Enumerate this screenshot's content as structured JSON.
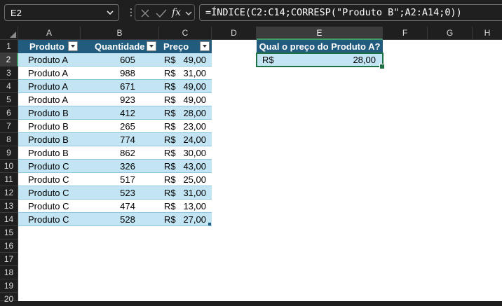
{
  "formula_bar": {
    "name_box": "E2",
    "fx_label": "fx",
    "formula": "=ÍNDICE(C2:C14;CORRESP(\"Produto B\";A2:A14;0))"
  },
  "columns": [
    "A",
    "B",
    "C",
    "D",
    "E",
    "F",
    "G",
    "H"
  ],
  "rows": [
    "1",
    "2",
    "3",
    "4",
    "5",
    "6",
    "7",
    "8",
    "9",
    "10",
    "11",
    "12",
    "13",
    "14",
    "15",
    "16",
    "17",
    "18",
    "19",
    "20"
  ],
  "table": {
    "headers": {
      "produto": "Produto",
      "quantidade": "Quantidade",
      "preco": "Preço"
    },
    "currency": "R$",
    "rows": [
      {
        "produto": "Produto A",
        "quantidade": "605",
        "preco": "49,00"
      },
      {
        "produto": "Produto A",
        "quantidade": "988",
        "preco": "31,00"
      },
      {
        "produto": "Produto A",
        "quantidade": "671",
        "preco": "49,00"
      },
      {
        "produto": "Produto A",
        "quantidade": "923",
        "preco": "49,00"
      },
      {
        "produto": "Produto B",
        "quantidade": "412",
        "preco": "28,00"
      },
      {
        "produto": "Produto B",
        "quantidade": "265",
        "preco": "23,00"
      },
      {
        "produto": "Produto B",
        "quantidade": "774",
        "preco": "24,00"
      },
      {
        "produto": "Produto B",
        "quantidade": "862",
        "preco": "30,00"
      },
      {
        "produto": "Produto C",
        "quantidade": "326",
        "preco": "43,00"
      },
      {
        "produto": "Produto C",
        "quantidade": "517",
        "preco": "25,00"
      },
      {
        "produto": "Produto C",
        "quantidade": "523",
        "preco": "31,00"
      },
      {
        "produto": "Produto C",
        "quantidade": "474",
        "preco": "13,00"
      },
      {
        "produto": "Produto C",
        "quantidade": "528",
        "preco": "27,00"
      }
    ]
  },
  "lookup": {
    "question": "Qual o preço do Produto A?",
    "currency": "R$",
    "result": "28,00"
  },
  "colors": {
    "header_fill": "#215c7e",
    "band_fill": "#c2e4f3",
    "selection": "#1e7145"
  }
}
